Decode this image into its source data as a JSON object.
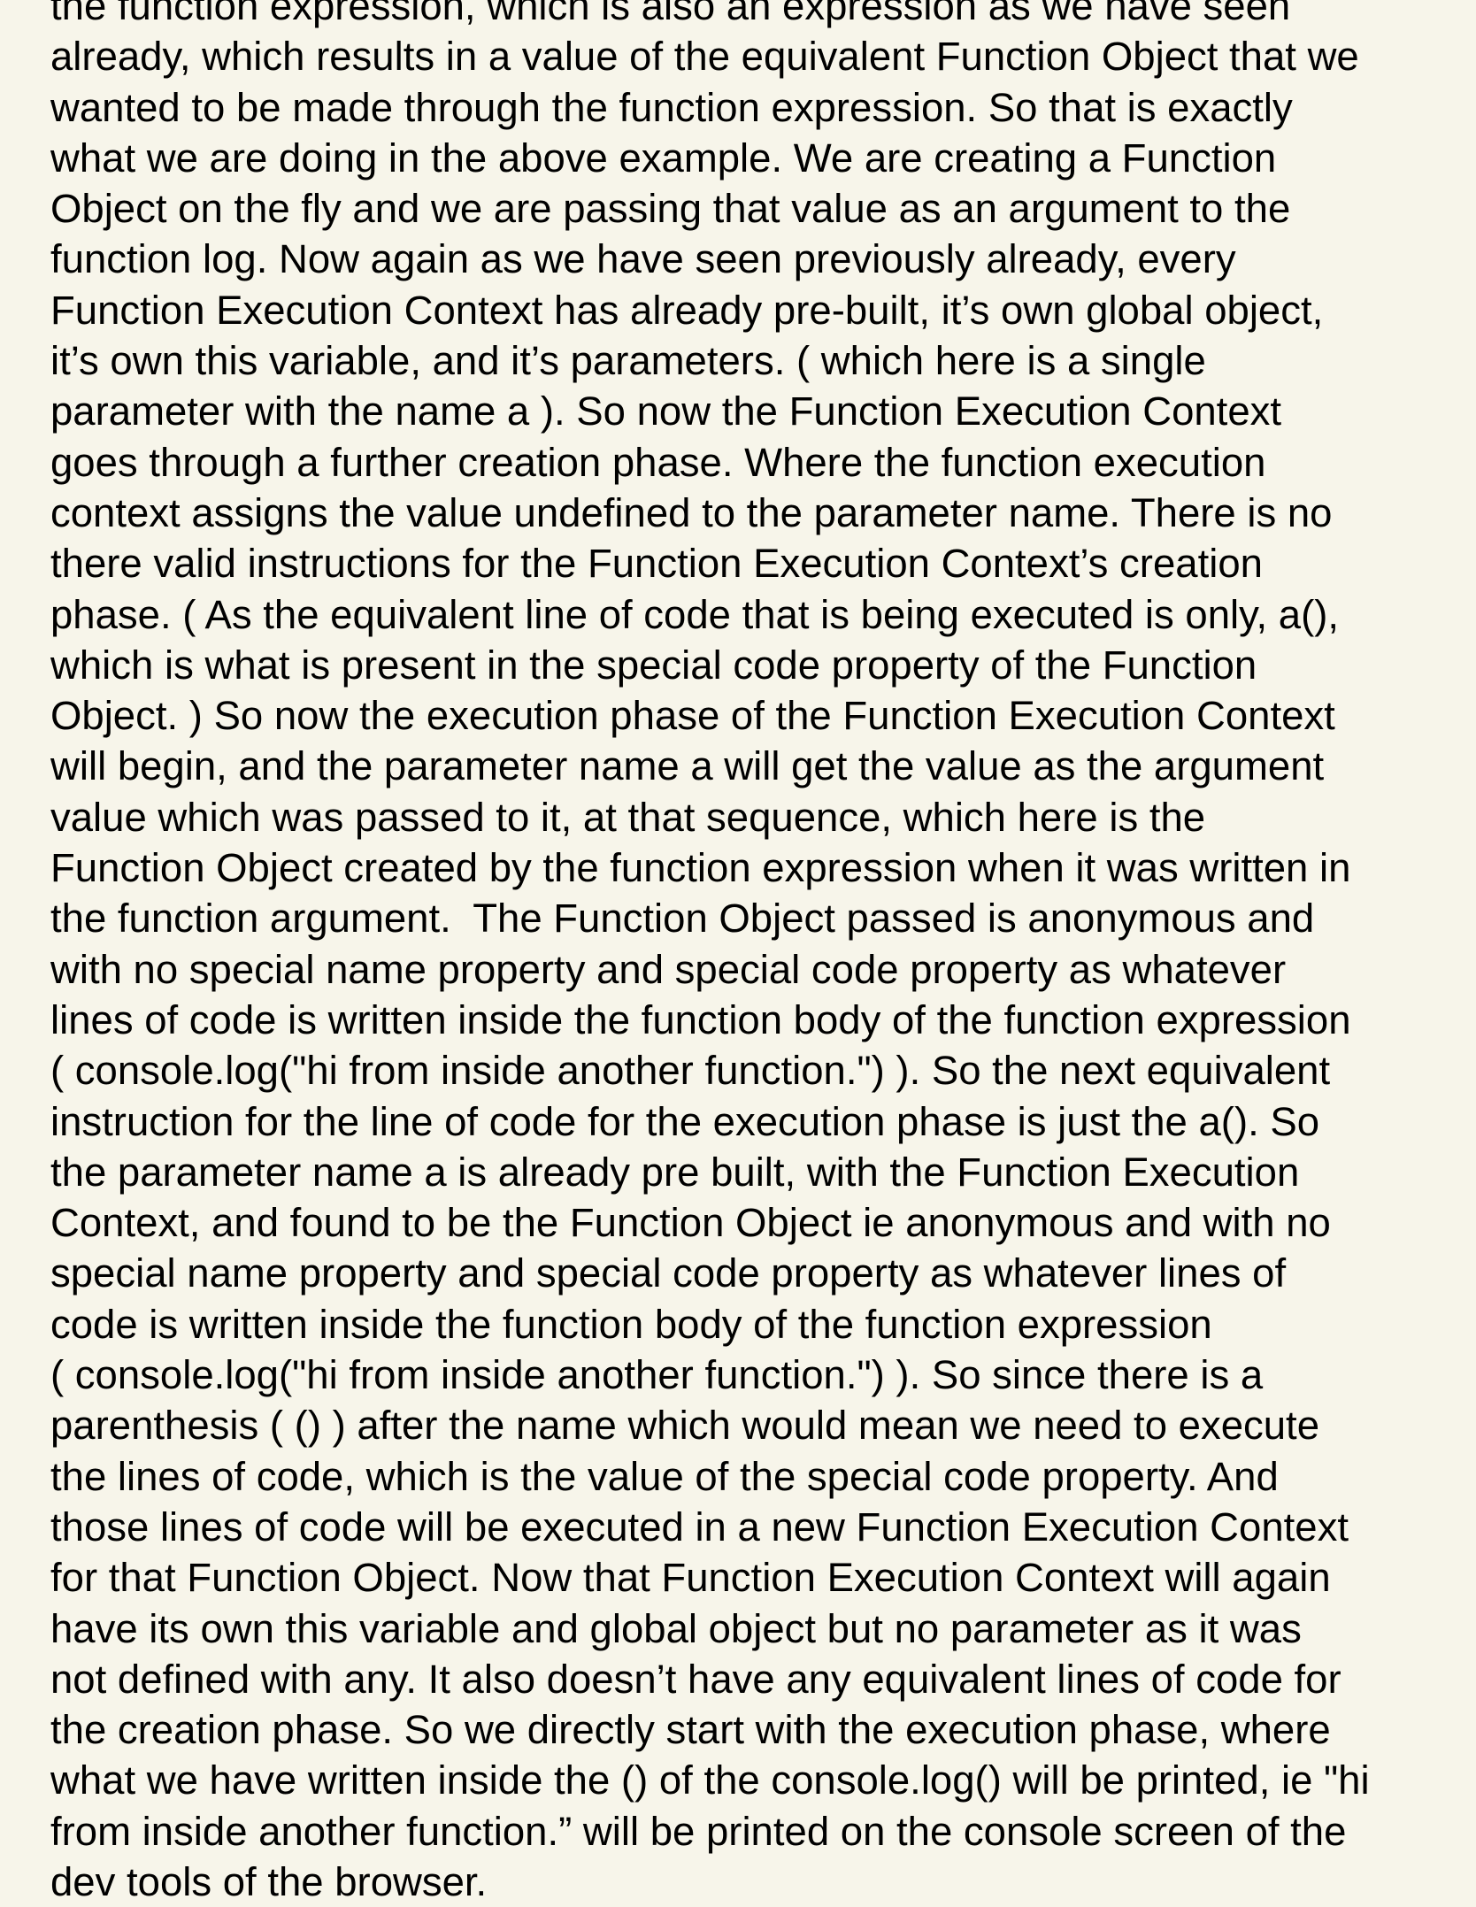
{
  "document": {
    "lines": [
      "the function expression, which is also an expression as we have seen",
      "already, which results in a value of the equivalent Function Object that we",
      "wanted to be made through the function expression. So that is exactly",
      "what we are doing in the above example. We are creating a Function",
      "Object on the fly and we are passing that value as an argument to the",
      "function log. Now again as we have seen previously already, every",
      "Function Execution Context has already pre-built, it’s own global object,",
      "it’s own this variable, and it’s parameters. ( which here is a single",
      "parameter with the name a ). So now the Function Execution Context",
      "goes through a further creation phase. Where the function execution",
      "context assigns the value undefined to the parameter name. There is no",
      "there valid instructions for the Function Execution Context’s creation",
      "phase. ( As the equivalent line of code that is being executed is only, a(),",
      "which is what is present in the special code property of the Function",
      "Object. ) So now the execution phase of the Function Execution Context",
      "will begin, and the parameter name a will get the value as the argument",
      "value which was passed to it, at that sequence, which here is the",
      "Function Object created by the function expression when it was written in",
      "the function argument.  The Function Object passed is anonymous and",
      "with no special name property and special code property as whatever",
      "lines of code is written inside the function body of the function expression",
      "( console.log(\"hi from inside another function.\") ). So the next equivalent",
      "instruction for the line of code for the execution phase is just the a(). So",
      "the parameter name a is already pre built, with the Function Execution",
      "Context, and found to be the Function Object ie anonymous and with no",
      "special name property and special code property as whatever lines of",
      "code is written inside the function body of the function expression",
      "( console.log(\"hi from inside another function.\") ). So since there is a",
      "parenthesis ( () ) after the name which would mean we need to execute",
      "the lines of code, which is the value of the special code property. And",
      "those lines of code will be executed in a new Function Execution Context",
      "for that Function Object. Now that Function Execution Context will again",
      "have its own this variable and global object but no parameter as it was",
      "not defined with any. It also doesn’t have any equivalent lines of code for",
      "the creation phase. So we directly start with the execution phase, where",
      "what we have written inside the () of the console.log() will be printed, ie \"hi",
      "from inside another function.” will be printed on the console screen of the",
      "dev tools of the browser."
    ]
  }
}
